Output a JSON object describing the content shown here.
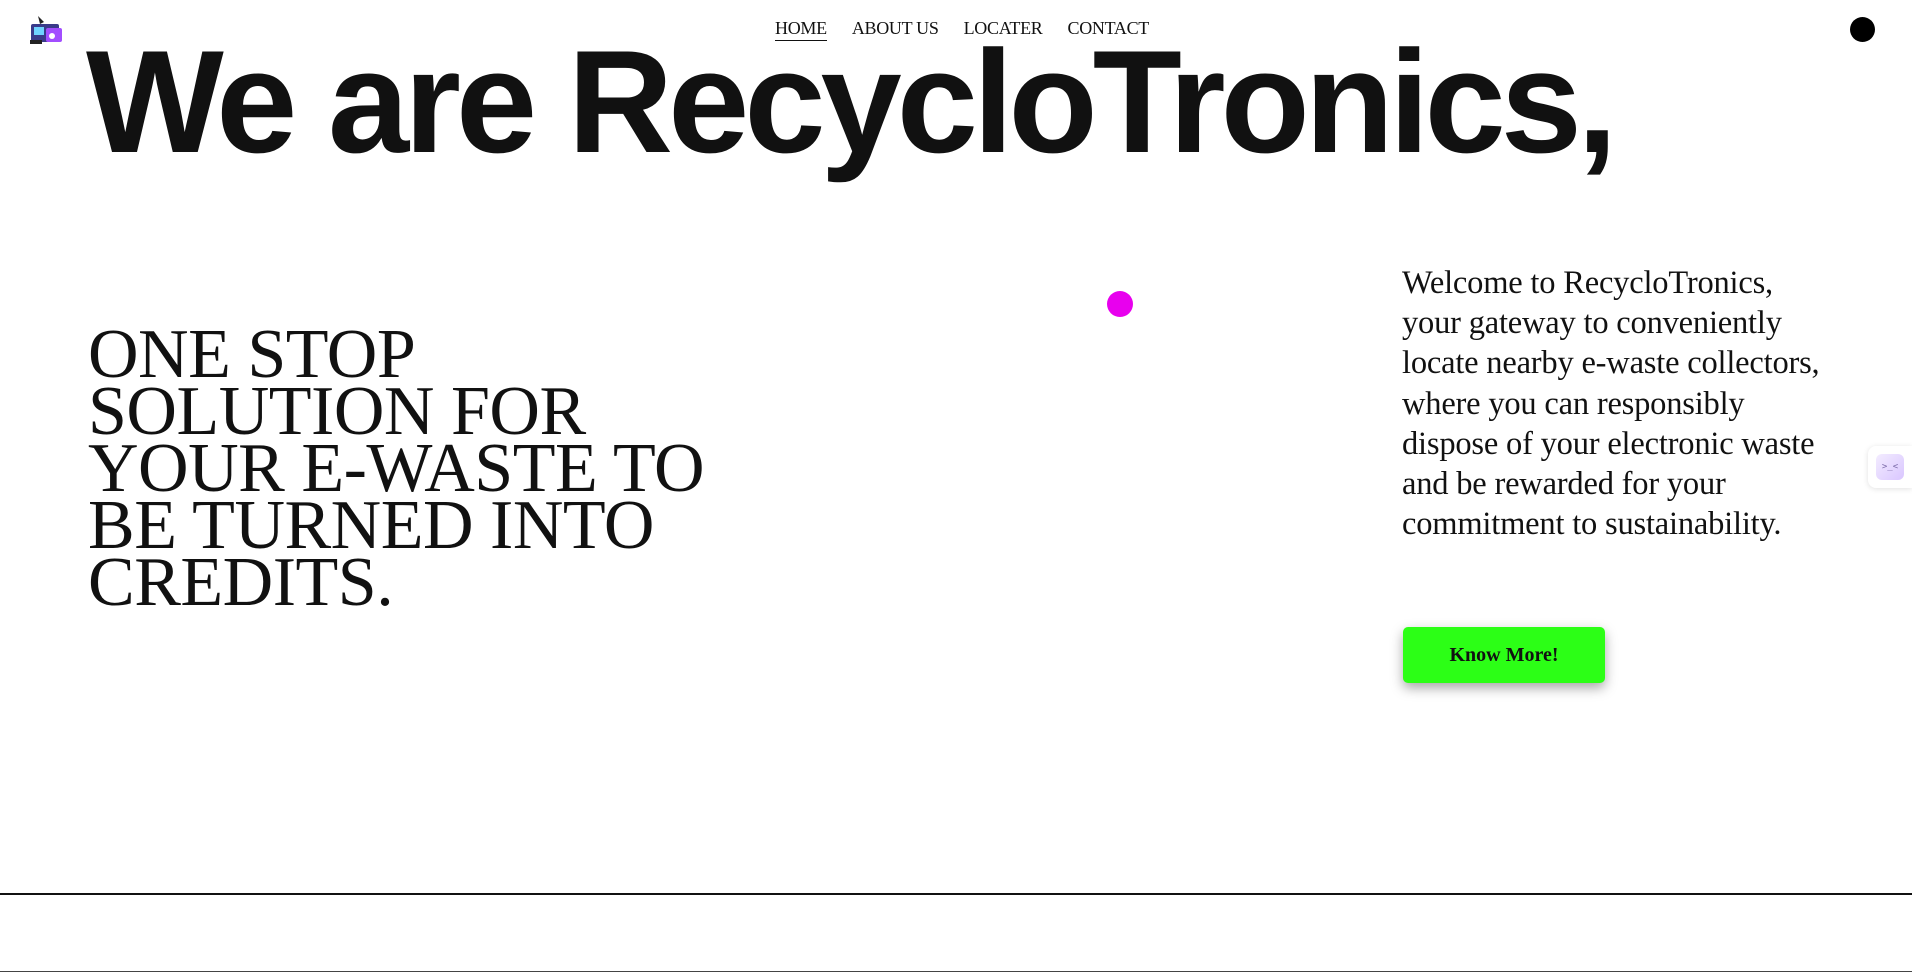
{
  "header": {
    "logo_icon": "recyclotronics-logo-icon",
    "nav": [
      {
        "label": "HOME",
        "active": true
      },
      {
        "label": "ABOUT US",
        "active": false
      },
      {
        "label": "LOCATER",
        "active": false
      },
      {
        "label": "CONTACT",
        "active": false
      }
    ],
    "menu_dot_icon": "black-circle-icon"
  },
  "hero": {
    "title": "We are RecycloTronics,"
  },
  "main": {
    "tagline": "ONE STOP SOLUTION FOR YOUR E-WASTE TO BE TURNED INTO CREDITS.",
    "cursor_dot_color": "#e800ee",
    "welcome_text": "Welcome to RecycloTronics, your gateway to conveniently locate nearby e-waste collectors, where you can responsibly dispose of your electronic waste and be rewarded for your commitment to sustainability.",
    "cta_label": "Know More!",
    "cta_color": "#2cff16"
  },
  "side_widget": {
    "icon": "assistant-face-icon",
    "glyph": ">_<"
  }
}
